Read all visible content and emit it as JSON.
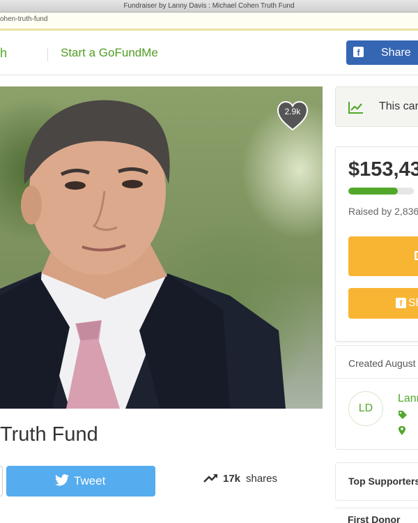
{
  "window": {
    "title": "Fundraiser by Lanny Davis : Michael Cohen Truth Fund",
    "url": "ohen-truth-fund"
  },
  "header": {
    "partial_link": "h",
    "start_link": "Start a GoFundMe",
    "share_label": "Share"
  },
  "hero": {
    "heart_count": "2.9k"
  },
  "campaign": {
    "title": "Truth Fund"
  },
  "social": {
    "tweet_label": "Tweet",
    "shares_count": "17k",
    "shares_text": " shares"
  },
  "sidebar": {
    "notice_text": "This car",
    "amount": "$153,43",
    "progress_fraction": 0.75,
    "raised_text": "Raised by 2,836",
    "donate_label": "D",
    "share_label": "Sh",
    "created_text": "Created August",
    "organizer_initials": "LD",
    "organizer_name": "Lann",
    "top_supporters_label": "Top Supporters",
    "first_donor_label": "First Donor"
  },
  "colors": {
    "brand_green": "#52a82b",
    "facebook_blue": "#3566b3",
    "twitter_blue": "#55acee",
    "donate_orange": "#f8b533"
  },
  "icons": [
    "facebook-icon",
    "heart-icon",
    "twitter-bird-icon",
    "trending-up-icon",
    "chart-line-icon",
    "tag-icon",
    "location-pin-icon"
  ]
}
